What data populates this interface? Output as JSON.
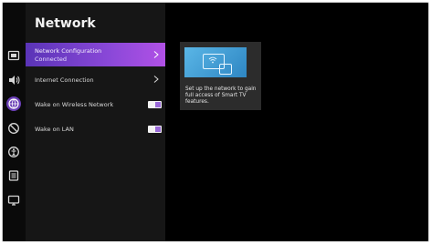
{
  "panel": {
    "title": "Network",
    "items": [
      {
        "label": "Network Configuration",
        "sublabel": "Connected",
        "type": "submenu",
        "selected": true
      },
      {
        "label": "Internet Connection",
        "type": "submenu",
        "selected": false
      },
      {
        "label": "Wake on Wireless Network",
        "type": "toggle",
        "value": "on"
      },
      {
        "label": "Wake on LAN",
        "type": "toggle",
        "value": "on"
      }
    ]
  },
  "rail": {
    "icons": [
      "picture-icon",
      "sound-icon",
      "network-icon",
      "privacy-icon",
      "accessibility-icon",
      "system-icon",
      "support-icon"
    ],
    "active": "network-icon"
  },
  "info_card": {
    "text": "Set up the network to gain full access of Smart TV features."
  },
  "colors": {
    "accent_start": "#5a34b7",
    "accent_end": "#b151e6",
    "background": "#000000",
    "panel": "#161616"
  }
}
